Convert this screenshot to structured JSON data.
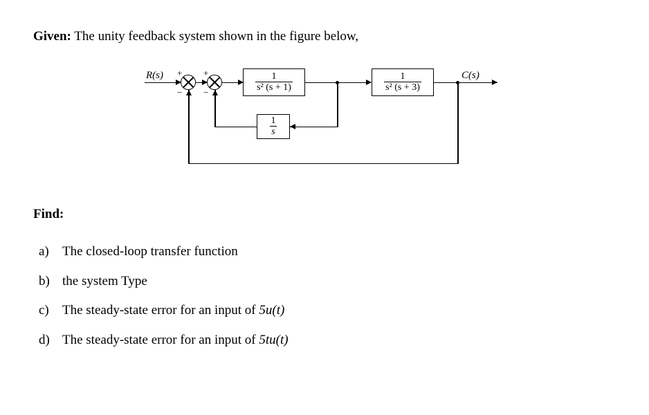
{
  "given_label": "Given:",
  "given_text": " The unity feedback system shown in the figure below,",
  "diagram": {
    "input_label": "R(s)",
    "output_label": "C(s)",
    "sum1_top_sign": "+",
    "sum1_bot_sign": "−",
    "sum2_top_sign": "+",
    "sum2_bot_sign": "−",
    "block1_num": "1",
    "block1_den": "s² (s + 1)",
    "block2_num": "1",
    "block2_den": "s² (s + 3)",
    "feedback_num": "1",
    "feedback_den": "s"
  },
  "find_label": "Find:",
  "questions": {
    "a": {
      "letter": "a)",
      "text": "The closed-loop transfer function"
    },
    "b": {
      "letter": "b)",
      "text": "the system Type"
    },
    "c": {
      "letter": "c)",
      "text_pre": "The steady-state error for an input of ",
      "math": "5u(t)"
    },
    "d": {
      "letter": "d)",
      "text_pre": "The steady-state error for an input of ",
      "math": "5tu(t)"
    }
  }
}
